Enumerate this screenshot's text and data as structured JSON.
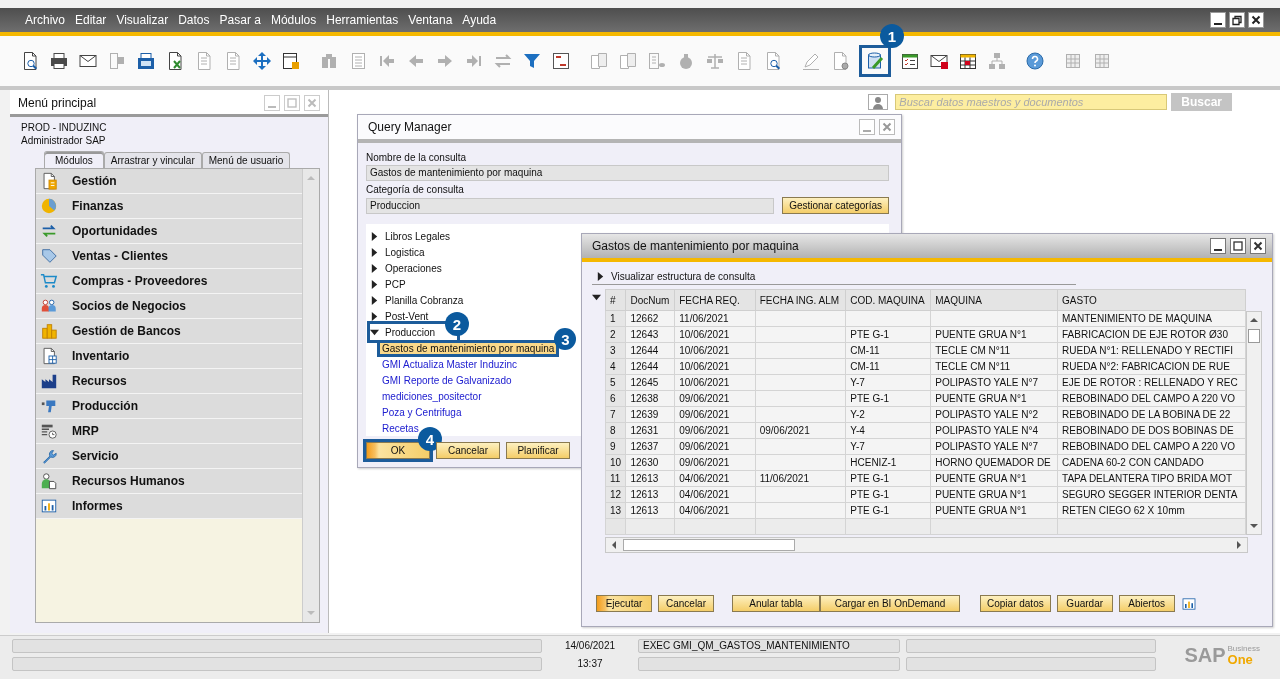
{
  "window": {
    "menu": [
      "Archivo",
      "Editar",
      "Visualizar",
      "Datos",
      "Pasar a",
      "Módulos",
      "Herramientas",
      "Ventana",
      "Ayuda"
    ]
  },
  "toolbar": {
    "callout": "1"
  },
  "left_panel": {
    "title": "Menú principal",
    "company": "PROD - INDUZINC",
    "user": "Administrador SAP",
    "tabs": [
      {
        "label": "Módulos",
        "selected": true
      },
      {
        "label": "Arrastrar y vincular",
        "selected": false
      },
      {
        "label": "Menú de usuario",
        "selected": false
      }
    ],
    "modules": [
      {
        "label": "Gestión"
      },
      {
        "label": "Finanzas"
      },
      {
        "label": "Oportunidades"
      },
      {
        "label": "Ventas - Clientes"
      },
      {
        "label": "Compras - Proveedores"
      },
      {
        "label": "Socios de Negocios"
      },
      {
        "label": "Gestión de Bancos"
      },
      {
        "label": "Inventario"
      },
      {
        "label": "Recursos"
      },
      {
        "label": "Producción"
      },
      {
        "label": "MRP"
      },
      {
        "label": "Servicio"
      },
      {
        "label": "Recursos Humanos"
      },
      {
        "label": "Informes"
      }
    ]
  },
  "search": {
    "placeholder": "Buscar datos maestros y documentos",
    "button": {
      "label": "Buscar",
      "disabled": true
    }
  },
  "query_manager": {
    "title": "Query Manager",
    "active": false,
    "name_label": "Nombre de la consulta",
    "name_value": "Gastos de mantenimiento por maquina",
    "category_label": "Categoría de consulta",
    "category_value": "Produccion",
    "manage_button": "Gestionar categorías",
    "tree": [
      {
        "label": "Libros Legales",
        "expanded": false
      },
      {
        "label": "Logistica",
        "expanded": false
      },
      {
        "label": "Operaciones",
        "expanded": false
      },
      {
        "label": "PCP",
        "expanded": false
      },
      {
        "label": "Planilla Cobranza",
        "expanded": false
      },
      {
        "label": "Post-Vent",
        "expanded": false
      },
      {
        "label": "Produccion",
        "expanded": true,
        "callout": "2",
        "children": [
          {
            "label": "Gastos de mantenimiento por maquina",
            "selected": true,
            "callout": "3"
          },
          {
            "label": "GMI Actualiza Master Induzinc",
            "selected": false
          },
          {
            "label": "GMI Reporte de Galvanizado",
            "selected": false
          },
          {
            "label": "mediciones_positector",
            "selected": false
          },
          {
            "label": "Poza y Centrifuga",
            "selected": false
          },
          {
            "label": "Recetas",
            "selected": false
          }
        ]
      }
    ],
    "buttons": [
      {
        "label": "OK",
        "default": true,
        "callout": "4"
      },
      {
        "label": "Cancelar",
        "default": false
      },
      {
        "label": "Planificar",
        "default": false
      }
    ]
  },
  "results_window": {
    "title": "Gastos de mantenimiento por maquina",
    "active": true,
    "structure_toggle": {
      "label": "Visualizar estructura de consulta",
      "expanded": false
    },
    "table": {
      "expanded": true,
      "columns": [
        "#",
        "DocNum",
        "FECHA REQ.",
        "FECHA ING. ALM",
        "COD. MAQUINA",
        "MAQUINA",
        "GASTO"
      ],
      "rows": [
        {
          "n": "1",
          "doc_num": "12662",
          "fecha_req": "11/06/2021",
          "gasto": "MANTENIMIENTO DE MAQUINA"
        },
        {
          "n": "2",
          "doc_num": "12643",
          "fecha_req": "10/06/2021",
          "cod_maquina": "PTE G-1",
          "maquina": "PUENTE GRUA N°1",
          "gasto": "FABRICACION DE EJE  ROTOR Ø30"
        },
        {
          "n": "3",
          "doc_num": "12644",
          "fecha_req": "10/06/2021",
          "cod_maquina": "CM-11",
          "maquina": "TECLE CM N°11",
          "gasto": "RUEDA N°1: RELLENADO Y RECTIFI"
        },
        {
          "n": "4",
          "doc_num": "12644",
          "fecha_req": "10/06/2021",
          "cod_maquina": "CM-11",
          "maquina": "TECLE CM N°11",
          "gasto": "RUEDA N°2: FABRICACION DE RUE"
        },
        {
          "n": "5",
          "doc_num": "12645",
          "fecha_req": "10/06/2021",
          "cod_maquina": "Y-7",
          "maquina": "POLIPASTO YALE N°7",
          "gasto": "EJE DE ROTOR : RELLENADO Y REC"
        },
        {
          "n": "6",
          "doc_num": "12638",
          "fecha_req": "09/06/2021",
          "cod_maquina": "PTE G-1",
          "maquina": "PUENTE GRUA N°1",
          "gasto": "REBOBINADO DEL CAMPO A 220 VO"
        },
        {
          "n": "7",
          "doc_num": "12639",
          "fecha_req": "09/06/2021",
          "cod_maquina": "Y-2",
          "maquina": "POLIPASTO YALE N°2",
          "gasto": "REBOBINADO DE LA BOBINA DE 22"
        },
        {
          "n": "8",
          "doc_num": "12631",
          "fecha_req": "09/06/2021",
          "fecha_ing_alm": "09/06/2021",
          "cod_maquina": "Y-4",
          "maquina": "POLIPASTO YALE N°4",
          "gasto": "REBOBINADO DE DOS BOBINAS DE"
        },
        {
          "n": "9",
          "doc_num": "12637",
          "fecha_req": "09/06/2021",
          "cod_maquina": "Y-7",
          "maquina": "POLIPASTO YALE N°7",
          "gasto": "REBOBINADO DEL CAMPO A 220 VO"
        },
        {
          "n": "10",
          "doc_num": "12630",
          "fecha_req": "09/06/2021",
          "cod_maquina": "HCENIZ-1",
          "maquina": "HORNO QUEMADOR DE",
          "gasto": "CADENA 60-2 CON CANDADO"
        },
        {
          "n": "11",
          "doc_num": "12613",
          "fecha_req": "04/06/2021",
          "fecha_ing_alm": "11/06/2021",
          "cod_maquina": "PTE G-1",
          "maquina": "PUENTE GRUA N°1",
          "gasto": "TAPA DELANTERA TIPO BRIDA MOT"
        },
        {
          "n": "12",
          "doc_num": "12613",
          "fecha_req": "04/06/2021",
          "cod_maquina": "PTE G-1",
          "maquina": "PUENTE GRUA N°1",
          "gasto": "SEGURO SEGGER INTERIOR DENTA"
        },
        {
          "n": "13",
          "doc_num": "12613",
          "fecha_req": "04/06/2021",
          "cod_maquina": "PTE G-1",
          "maquina": "PUENTE GRUA N°1",
          "gasto": "RETEN CIEGO 62 X 10mm"
        }
      ]
    },
    "buttons": [
      {
        "label": "Ejecutar",
        "default": true
      },
      {
        "label": "Cancelar",
        "default": false
      },
      {
        "label": "Anular tabla",
        "default": false
      },
      {
        "label": "Cargar en BI OnDemand",
        "default": false
      },
      {
        "label": "Copiar datos",
        "default": false
      },
      {
        "label": "Guardar",
        "default": false
      },
      {
        "label": "Abiertos",
        "default": false
      }
    ]
  },
  "status_bar": {
    "date": "14/06/2021",
    "time": "13:37",
    "message": "EXEC GMI_QM_GASTOS_MANTENIMIENTO"
  },
  "logo": {
    "brand": "SAP",
    "line_1": "Business",
    "line_2": "One"
  }
}
